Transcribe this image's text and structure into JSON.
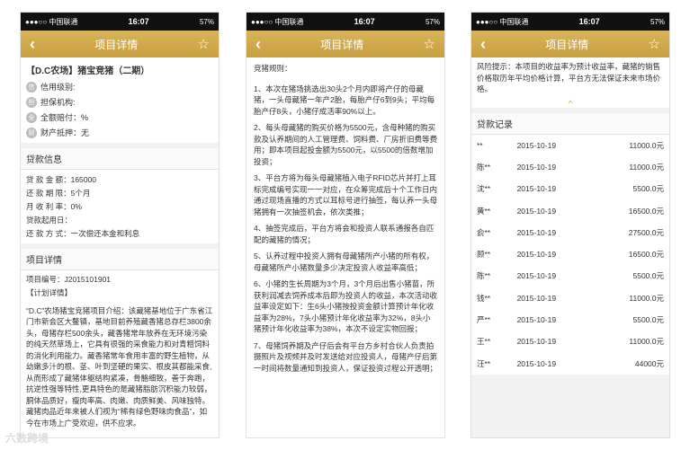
{
  "status": {
    "carrier": "●●●○○ 中国联通",
    "time": "16:07",
    "battery": "57%"
  },
  "nav": {
    "title": "项目详情",
    "back": "‹",
    "star": "☆"
  },
  "p1": {
    "title": "【D.C农场】猪宝竞猪（二期）",
    "rows": [
      {
        "icon": "信",
        "text": "信用级别:"
      },
      {
        "icon": "担",
        "text": "担保机构:"
      },
      {
        "icon": "全",
        "text": "全额赔付：%"
      },
      {
        "icon": "财",
        "text": "财产抵押：无"
      }
    ],
    "loan_head": "贷款信息",
    "loan": [
      "贷 款 金 额：165000",
      "还 款 期 限：5个月",
      "月 收 利 率：0%",
      "贷款起用日：",
      "还 款 方 式：一次偿还本金和利息"
    ],
    "proj_head": "项目详情",
    "proj_no": "项目编号：J2015101901",
    "plan": "【计划详情】",
    "desc": "“D.C”农场猪宝竞猪项目介绍：该藏猪基地位于广东省江门市新会区大鳌镇，基地目前养殖藏香猪总存栏3800余头，母猪存栏500余头，藏香猪常年放养在无环境污染的纯天然草场上，它具有很强的采食能力和对青粗饲料的消化利用能力。藏香猪常年食用丰富的野生植物，从幼嫩多汁的根、茎、叶到坚硬的果实、根皮其都能采食,从而形成了藏猪体躯结构紧凑，骨骼细致，善于奔跑，抗逆性强等特性,更具特色的是藏猪脂肪沉积能力较弱，胴体品质好，瘦肉率高、肉嫩、肉质鲜美、风味独特。藏猪肉品近年来被人们视为“稀有绿色野味肉食品”，如今在市场上广受欢迎，供不应求。"
  },
  "p2": {
    "rules_title": "竞猪规则：",
    "paras": [
      "1、本次在猪场挑选出30头2个月内即将产仔的母藏猪，一头母藏猪一年产2胎，每胎产仔6到9头；平均每胎产仔8头，小猪仔成活率90%以上。",
      "2、每头母藏猪的购买价格为5500元，含母种猪的购买款及认养期间的人工管理费、饲料费、厂房折旧费等费用；即本项目起投金额为5500元，以5500的倍数增加投资；",
      "3、平台方将为每头母藏猪植入电子RFID芯片并打上耳标完成编号实现一一对应，在众筹完成后十个工作日内通过现场直播的方式以耳标号进行抽签，每认养一头母猪拥有一次抽签机会，依次类推；",
      "4、抽签完成后，平台方将会和投资人联系通报各自匹配的藏猪的情况；",
      "5、认养过程中投资人拥有母藏猪所产小猪的所有权，母藏猪所产小猪数量多少决定投资人收益率高低；",
      "6、小猪的生长周期为3个月，3个月后出售小猪苗，所获利润减去饲养成本后即为投资人的收益，本次活动收益率设定如下：生6头小猪按投资金额计算预计年化收益率为28%，7头小猪预计年化收益率为32%，8头小猪预计年化收益率为38%，本次不设定实物回报；",
      "7、母猪饲养期及产仔后会有平台方乡村合伙人负责拍摄照片及视频并及时发送给对应投资人，母猪产仔后第一时间将数量通知到投资人，保证投资过程公开透明；"
    ]
  },
  "p3": {
    "risk": "风险提示：本项目的收益率为预计收益率，藏猪的销售价格取历年平均价格计算，平台方无法保证未来市场价格。",
    "chevron": "^",
    "rec_head": "贷款记录",
    "records": [
      {
        "name": "**",
        "date": "2015-10-19",
        "amount": "11000.0元"
      },
      {
        "name": "陈**",
        "date": "2015-10-19",
        "amount": "11000.0元"
      },
      {
        "name": "沈**",
        "date": "2015-10-19",
        "amount": "5500.0元"
      },
      {
        "name": "黄**",
        "date": "2015-10-19",
        "amount": "16500.0元"
      },
      {
        "name": "俞**",
        "date": "2015-10-19",
        "amount": "27500.0元"
      },
      {
        "name": "顾**",
        "date": "2015-10-19",
        "amount": "16500.0元"
      },
      {
        "name": "陈**",
        "date": "2015-10-19",
        "amount": "5500.0元"
      },
      {
        "name": "钱**",
        "date": "2015-10-19",
        "amount": "11000.0元"
      },
      {
        "name": "严**",
        "date": "2015-10-19",
        "amount": "5500.0元"
      },
      {
        "name": "王**",
        "date": "2015-10-19",
        "amount": "11000.0元"
      },
      {
        "name": "汪**",
        "date": "2015-10-19",
        "amount": "44000元"
      }
    ]
  },
  "watermark": "六数跨境"
}
